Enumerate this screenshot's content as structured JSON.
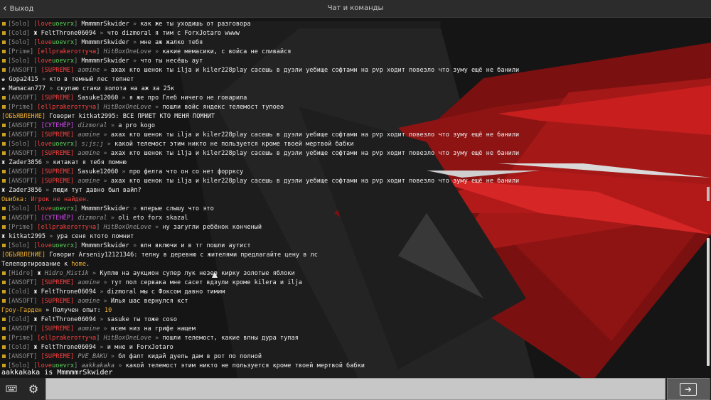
{
  "topbar": {
    "back_label": "Выход",
    "title": "Чат и команды"
  },
  "messages": [
    [
      [
        "[Solo] ",
        "grey"
      ],
      [
        "[love",
        "red"
      ],
      [
        "uoevrx",
        "green"
      ],
      [
        "] ",
        "grey"
      ],
      [
        "MmmmmrSkwider",
        "white"
      ],
      [
        " » ",
        "grey"
      ],
      [
        "как же ты уходишь от разговора",
        "white"
      ]
    ],
    [
      [
        "[Cold] ",
        "grey"
      ],
      [
        "♜ ",
        "white"
      ],
      [
        "FeltThrone06094",
        "white"
      ],
      [
        " » ",
        "grey"
      ],
      [
        " что dizmoral я тим с ForxJotaro wwww",
        "white"
      ]
    ],
    [
      [
        "[Solo] ",
        "grey"
      ],
      [
        "[love",
        "red"
      ],
      [
        "uoevrx",
        "green"
      ],
      [
        "] ",
        "grey"
      ],
      [
        "MmmmmrSkwider",
        "white"
      ],
      [
        " » ",
        "grey"
      ],
      [
        "мне аж жалко тебя",
        "white"
      ]
    ],
    [
      [
        "[Prime] ",
        "grey"
      ],
      [
        "[ellprakeroттуча",
        "red"
      ],
      [
        "] ",
        "grey"
      ],
      [
        "HitBoxOneLove",
        "italic"
      ],
      [
        " » ",
        "grey"
      ],
      [
        " какие мемасики, с войса не сливайся",
        "white"
      ]
    ],
    [
      [
        "[Solo] ",
        "grey"
      ],
      [
        "[love",
        "red"
      ],
      [
        "uoevrx",
        "green"
      ],
      [
        "] ",
        "grey"
      ],
      [
        "MmmmmrSkwider",
        "white"
      ],
      [
        " » ",
        "grey"
      ],
      [
        "что ты несёшь аут",
        "white"
      ]
    ],
    [
      [
        "[ANSOFT] ",
        "grey"
      ],
      [
        "[SUPREME] ",
        "red"
      ],
      [
        "aomine",
        "italic"
      ],
      [
        " » ",
        "grey"
      ],
      [
        " ахах кто шенок ты ilja и kiler228play сасешь в дуэли уебище софтами на pvp ходит повезло что зуму ещё не банили",
        "white"
      ]
    ],
    [
      [
        "♚ ",
        "white"
      ],
      [
        "Gopa2415",
        "white"
      ],
      [
        " » ",
        "grey"
      ],
      [
        " кто в темный лес тепнет",
        "white"
      ]
    ],
    [
      [
        "♚ ",
        "white"
      ],
      [
        "Mamacan777",
        "white"
      ],
      [
        " » ",
        "grey"
      ],
      [
        " скупаю стаки золота на аж за 25к",
        "white"
      ]
    ],
    [
      [
        "[ANSOFT] ",
        "grey"
      ],
      [
        "[SUPREME] ",
        "red"
      ],
      [
        "Sasuke12060",
        "white"
      ],
      [
        " » ",
        "grey"
      ],
      [
        " я же про Глеб ничего не говарила",
        "white"
      ]
    ],
    [
      [
        "[Prime] ",
        "grey"
      ],
      [
        "[ellprakeroттуча",
        "red"
      ],
      [
        "] ",
        "grey"
      ],
      [
        "HitBoxOneLove",
        "italic"
      ],
      [
        " » ",
        "grey"
      ],
      [
        " пошли войс яндекс телемост тупоео",
        "white"
      ]
    ],
    [
      [
        "[ОБЪЯВЛЕНИЕ] ",
        "gold"
      ],
      [
        "Говорит kitkat2995: ВСЕ ПРИЕТ КТО МЕНЯ ПОМНИТ",
        "white"
      ]
    ],
    [
      [
        "[ANSOFT] ",
        "grey"
      ],
      [
        "[СУТЕНЁР] ",
        "purple"
      ],
      [
        "dizmoral",
        "italic"
      ],
      [
        " » ",
        "grey"
      ],
      [
        "  а pro kogo",
        "white"
      ]
    ],
    [
      [
        "[ANSOFT] ",
        "grey"
      ],
      [
        "[SUPREME] ",
        "red"
      ],
      [
        "aomine",
        "italic"
      ],
      [
        " » ",
        "grey"
      ],
      [
        " ахах кто шенок ты ilja и kiler228play сасешь в дуэли уебище софтами на pvp ходит повезло что зуму ещё не банили",
        "white"
      ]
    ],
    [
      [
        "[Solo] ",
        "grey"
      ],
      [
        "[love",
        "red"
      ],
      [
        "uoevrx",
        "green"
      ],
      [
        "] ",
        "grey"
      ],
      [
        "s;js;j",
        "italic"
      ],
      [
        " » ",
        "grey"
      ],
      [
        "какой телемост этим никто не пользуется кроме твоей мертвой бабки",
        "white"
      ]
    ],
    [
      [
        "[ANSOFT] ",
        "grey"
      ],
      [
        "[SUPREME] ",
        "red"
      ],
      [
        "aomine",
        "italic"
      ],
      [
        " » ",
        "grey"
      ],
      [
        " ахах кто шенок ты ilja и kiler228play сасешь в дуэли уебище софтами на pvp ходит повезло что зуму ещё не банили",
        "white"
      ]
    ],
    [
      [
        "♜ ",
        "white"
      ],
      [
        "Zader3856",
        "white"
      ],
      [
        " » ",
        "grey"
      ],
      [
        "китакат я тебя помню",
        "white"
      ]
    ],
    [
      [
        "[ANSOFT] ",
        "grey"
      ],
      [
        "[SUPREME] ",
        "red"
      ],
      [
        "Sasuke12060",
        "white"
      ],
      [
        " » ",
        "grey"
      ],
      [
        " про фелта что он со нет форрксу",
        "white"
      ]
    ],
    [
      [
        "[ANSOFT] ",
        "grey"
      ],
      [
        "[SUPREME] ",
        "red"
      ],
      [
        "aomine",
        "italic"
      ],
      [
        " » ",
        "grey"
      ],
      [
        " ахах кто шенок ты ilja и kiler228play сасешь в дуэли уебище софтами на pvp ходит повезло что зуму ещё не банили",
        "white"
      ]
    ],
    [
      [
        "♜ ",
        "white"
      ],
      [
        "Zader3856",
        "white"
      ],
      [
        " » ",
        "grey"
      ],
      [
        "люди тут давно был вайп?",
        "white"
      ]
    ],
    [
      [
        "Ошибка: ",
        "gold"
      ],
      [
        "Игрок не найден.",
        "red"
      ]
    ],
    [
      [
        "[Solo] ",
        "grey"
      ],
      [
        "[love",
        "red"
      ],
      [
        "uoevrx",
        "green"
      ],
      [
        "] ",
        "grey"
      ],
      [
        "MmmmmrSkwider",
        "white"
      ],
      [
        " » ",
        "grey"
      ],
      [
        "вперые слышу что это",
        "white"
      ]
    ],
    [
      [
        "[ANSOFT] ",
        "grey"
      ],
      [
        "[СУТЕНЁР] ",
        "purple"
      ],
      [
        "dizmoral",
        "italic"
      ],
      [
        " » ",
        "grey"
      ],
      [
        "  oli eto forx skazal",
        "white"
      ]
    ],
    [
      [
        "[Prime] ",
        "grey"
      ],
      [
        "[ellprakeroттуча",
        "red"
      ],
      [
        "] ",
        "grey"
      ],
      [
        "HitBoxOneLove",
        "italic"
      ],
      [
        " » ",
        "grey"
      ],
      [
        " ну загугли ребёнок конченый",
        "white"
      ]
    ],
    [
      [
        "♜ ",
        "white"
      ],
      [
        "kitkat2995",
        "white"
      ],
      [
        " » ",
        "grey"
      ],
      [
        " ура сеня ктото помнит",
        "white"
      ]
    ],
    [
      [
        "[Solo] ",
        "grey"
      ],
      [
        "[love",
        "red"
      ],
      [
        "uoevrx",
        "green"
      ],
      [
        "] ",
        "grey"
      ],
      [
        "MmmmmrSkwider",
        "white"
      ],
      [
        " » ",
        "grey"
      ],
      [
        "впн включи и в тг пошли аутист",
        "white"
      ]
    ],
    [
      [
        "[ОБЪЯВЛЕНИЕ] ",
        "gold"
      ],
      [
        "Говорит Arseniy12121346: тепну в деревню с жителями предлагайте цену в лс",
        "white"
      ]
    ],
    [
      [
        "Телепортирование к ",
        "white"
      ],
      [
        "home",
        "gold"
      ],
      [
        ".",
        "white"
      ]
    ],
    [
      [
        "[Hidro] ",
        "grey"
      ],
      [
        "♜ ",
        "white"
      ],
      [
        "Hidro_Mistik",
        "italic"
      ],
      [
        " » ",
        "grey"
      ],
      [
        "Куплю на аукцион супер лук незер кирку золотые яблоки",
        "white"
      ]
    ],
    [
      [
        "[ANSOFT] ",
        "grey"
      ],
      [
        "[SUPREME] ",
        "red"
      ],
      [
        "aomine",
        "italic"
      ],
      [
        " » ",
        "grey"
      ],
      [
        " тут пол сервака мне сасет вдзули кроме kilera и ilja",
        "white"
      ]
    ],
    [
      [
        "[Cold] ",
        "grey"
      ],
      [
        "♜ ",
        "white"
      ],
      [
        "FeltThrone06094",
        "white"
      ],
      [
        " » ",
        "grey"
      ],
      [
        " dizmoral мы с Фоксом давно тимим",
        "white"
      ]
    ],
    [
      [
        "[ANSOFT] ",
        "grey"
      ],
      [
        "[SUPREME] ",
        "red"
      ],
      [
        "aomine",
        "italic"
      ],
      [
        " » ",
        "grey"
      ],
      [
        " Илья шас вернулся кст",
        "white"
      ]
    ],
    [
      [
        "Грoу-Гарден ",
        "gold"
      ],
      [
        "» Получен опыт: ",
        "white"
      ],
      [
        "10",
        "gold"
      ]
    ],
    [
      [
        "[Cold] ",
        "grey"
      ],
      [
        "♜ ",
        "white"
      ],
      [
        "FeltThrone06094",
        "white"
      ],
      [
        " » ",
        "grey"
      ],
      [
        " sasuke ты тоже соso",
        "white"
      ]
    ],
    [
      [
        "[ANSOFT] ",
        "grey"
      ],
      [
        "[SUPREME] ",
        "red"
      ],
      [
        "aomine",
        "italic"
      ],
      [
        " » ",
        "grey"
      ],
      [
        " всем низ на грифе нащем",
        "white"
      ]
    ],
    [
      [
        "[Prime] ",
        "grey"
      ],
      [
        "[ellprakeroттуча",
        "red"
      ],
      [
        "] ",
        "grey"
      ],
      [
        "HitBoxOneLove",
        "italic"
      ],
      [
        " » ",
        "grey"
      ],
      [
        " пошли телемост, какие впны дура тупая",
        "white"
      ]
    ],
    [
      [
        "[Cold] ",
        "grey"
      ],
      [
        "♜ ",
        "white"
      ],
      [
        "FeltThrone06094",
        "white"
      ],
      [
        " » ",
        "grey"
      ],
      [
        "  и мне и ForxJotaro",
        "white"
      ]
    ],
    [
      [
        "[ANSOFT] ",
        "grey"
      ],
      [
        "[SUPREME] ",
        "red"
      ],
      [
        "PVE_BAKU",
        "italic"
      ],
      [
        " » ",
        "grey"
      ],
      [
        " бл фалт кидай дуель дам в рот по полной",
        "white"
      ]
    ],
    [
      [
        "[Solo] ",
        "grey"
      ],
      [
        "[love",
        "red"
      ],
      [
        "uoevrx",
        "green"
      ],
      [
        "] ",
        "grey"
      ],
      [
        "aakkakaka",
        "italic"
      ],
      [
        " » ",
        "grey"
      ],
      [
        " какой телемост этим никто не пользуется кроме твоей мертвой бабки",
        "white"
      ]
    ]
  ],
  "preview_text": "aakkakaka is MmmmmrSkwider",
  "input": {
    "value": "",
    "placeholder": ""
  },
  "icons": {
    "back": "chevron-left-icon",
    "keyboard": "keyboard-icon",
    "settings": "gear-icon",
    "send": "send-icon"
  },
  "colors": {
    "accent_red": "#c81e1e",
    "tag_gold": "#c8a020",
    "input_bg": "#c7c7c7"
  }
}
